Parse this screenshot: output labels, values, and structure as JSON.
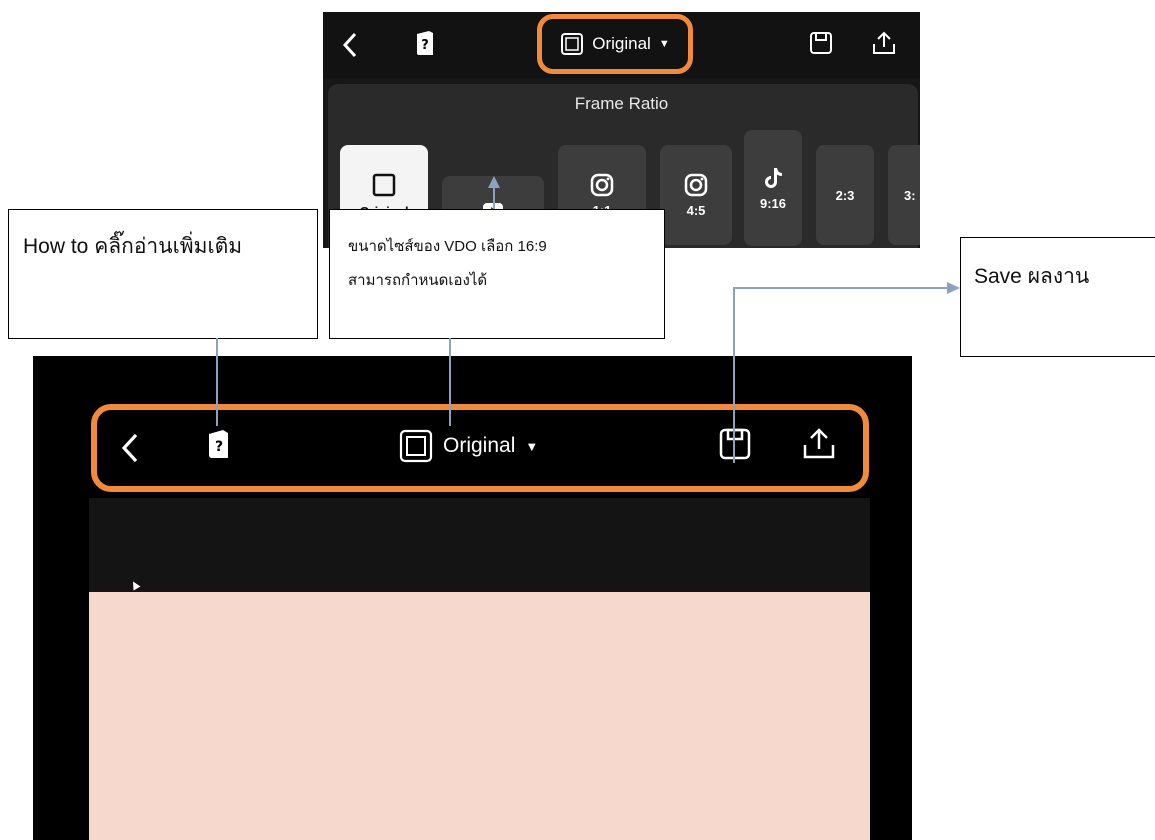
{
  "inset": {
    "ratio_label": "Original",
    "panel_title": "Frame Ratio",
    "options": [
      {
        "label": "Original",
        "icon": "square-icon",
        "selected": true
      },
      {
        "label": "",
        "icon": "youtube-icon",
        "selected": false
      },
      {
        "label": "1:1",
        "icon": "instagram-icon",
        "selected": false
      },
      {
        "label": "4:5",
        "icon": "instagram-icon",
        "selected": false
      },
      {
        "label": "9:16",
        "icon": "tiktok-icon",
        "selected": false
      },
      {
        "label": "2:3",
        "icon": "",
        "selected": false
      },
      {
        "label": "3:",
        "icon": "",
        "selected": false
      }
    ]
  },
  "callouts": {
    "howto": "How to คลิ๊กอ่านเพิ่มเติม",
    "ratio_line1": "ขนาดไซส์ของ VDO เลือก 16:9",
    "ratio_line2": "สามารถกำหนดเองได้",
    "save": "Save ผลงาน"
  },
  "app": {
    "ratio_label": "Original",
    "icons": [
      "back-icon",
      "help-book-icon",
      "square-icon",
      "dropdown-caret-icon",
      "save-icon",
      "export-icon"
    ]
  },
  "colors": {
    "highlight": "#f28a3c",
    "canvas": "#f6d9cc",
    "connector": "#8aa4c0"
  }
}
